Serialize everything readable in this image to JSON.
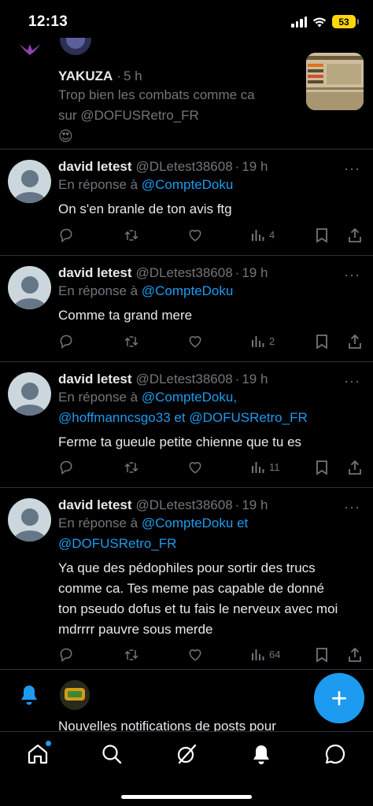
{
  "status_bar": {
    "time": "12:13",
    "battery": "53"
  },
  "top_post": {
    "name": "YAKUZA",
    "dot": "·",
    "time": "5 h",
    "text_line1": "Trop bien les combats comme ca",
    "text_line2": "sur @DOFUSRetro_FR",
    "emoji": "😍"
  },
  "posts": [
    {
      "name": "david letest",
      "handle": "@DLetest38608",
      "dot": "·",
      "time": "19 h",
      "reply_prefix": "En réponse à",
      "reply_mention": "@CompteDoku",
      "text": "On s'en branle de ton avis ftg",
      "views": "4"
    },
    {
      "name": "david letest",
      "handle": "@DLetest38608",
      "dot": "·",
      "time": "19 h",
      "reply_prefix": "En réponse à",
      "reply_mention": "@CompteDoku",
      "text": "Comme ta grand mere",
      "views": "2"
    },
    {
      "name": "david letest",
      "handle": "@DLetest38608",
      "dot": "·",
      "time": "19 h",
      "reply_prefix": "En réponse à",
      "reply_mention": "@CompteDoku,",
      "reply_mention2": "@hoffmanncsgo33",
      "reply_and": "et",
      "reply_mention3": "@DOFUSRetro_FR",
      "text": "Ferme ta gueule petite chienne que tu es",
      "views": "11"
    },
    {
      "name": "david letest",
      "handle": "@DLetest38608",
      "dot": "·",
      "time": "19 h",
      "reply_prefix": "En réponse à",
      "reply_mention": "@CompteDoku",
      "reply_and": "et",
      "reply_mention2": "@DOFUSRetro_FR",
      "text_lines": [
        "Ya que des pédophiles pour sortir des trucs",
        "comme ca. Tes meme pas capable de donné",
        "ton pseudo dofus et tu fais le nerveux avec moi",
        "mdrrrr pauvre sous merde"
      ],
      "views": "64"
    }
  ],
  "notification": {
    "text": "Nouvelles notifications de posts pour"
  },
  "fab": {
    "label": "+"
  },
  "more_label": "···",
  "colors": {
    "accent": "#1d9bf0",
    "muted": "#71767b",
    "divider": "#2f3336",
    "battery": "#ffd60a"
  },
  "tabs": [
    "home-icon",
    "search-icon",
    "grok-icon",
    "notifications-icon",
    "messages-icon"
  ]
}
